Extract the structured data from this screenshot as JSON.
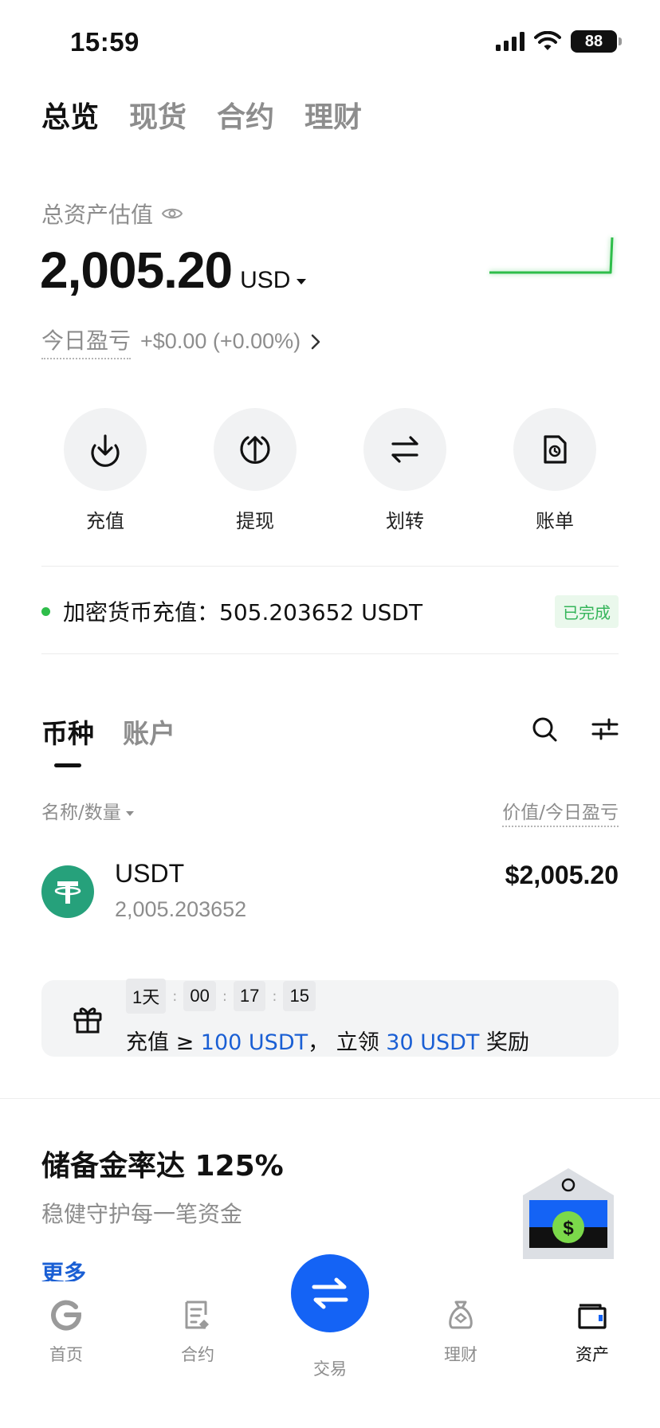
{
  "status_bar": {
    "time": "15:59",
    "battery": "88"
  },
  "top_tabs": [
    {
      "label": "总览",
      "active": true
    },
    {
      "label": "现货",
      "active": false
    },
    {
      "label": "合约",
      "active": false
    },
    {
      "label": "理财",
      "active": false
    }
  ],
  "assets": {
    "label": "总资产估值",
    "value": "2,005.20",
    "currency": "USD",
    "pnl_label": "今日盈亏",
    "pnl_value": "+$0.00 (+0.00%)"
  },
  "actions": [
    {
      "label": "充值",
      "icon": "deposit-icon"
    },
    {
      "label": "提现",
      "icon": "withdraw-icon"
    },
    {
      "label": "划转",
      "icon": "transfer-icon"
    },
    {
      "label": "账单",
      "icon": "bill-icon"
    }
  ],
  "deposit_notice": {
    "text": "加密货币充值：505.203652 USDT",
    "status": "已完成"
  },
  "list_tabs": [
    {
      "label": "币种",
      "active": true
    },
    {
      "label": "账户",
      "active": false
    }
  ],
  "columns": {
    "left": "名称/数量",
    "right": "价值/今日盈亏"
  },
  "coins": [
    {
      "name": "USDT",
      "amount": "2,005.203652",
      "value": "$2,005.20"
    }
  ],
  "promo": {
    "timer": [
      "1天",
      "00",
      "17",
      "15"
    ],
    "text_prefix": "充值 ≥ ",
    "hl1": "100 USDT",
    "text_mid": "， 立领 ",
    "hl2": "30 USDT",
    "text_suffix": " 奖励"
  },
  "reserve": {
    "title": "储备金率达 125%",
    "subtitle": "稳健守护每一笔资金",
    "more": "更多"
  },
  "bottom_nav": [
    {
      "label": "首页",
      "active": false
    },
    {
      "label": "合约",
      "active": false
    },
    {
      "label": "交易",
      "active": false
    },
    {
      "label": "理财",
      "active": false
    },
    {
      "label": "资产",
      "active": true
    }
  ],
  "colors": {
    "accent": "#1463f5",
    "positive": "#2ebd4a",
    "usdt": "#26a17b",
    "link": "#1a5fd4"
  }
}
